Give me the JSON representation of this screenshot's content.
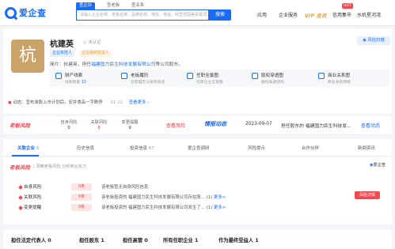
{
  "header": {
    "logo_text": "爱企查",
    "tabs": [
      "查企业",
      "查老板",
      "查关系"
    ],
    "search_placeholder": "请输入企业名称、老板名称、品牌名称、地址、电话、经营范围等关键词，如 \"阳光\"",
    "search_button": "搜索",
    "nav": [
      "应用",
      "企业服务"
    ],
    "vip": "VIP 会员",
    "hot_badge": "HOT",
    "nav2": [
      "信用集市",
      "水机星河湾"
    ]
  },
  "company": {
    "logo_char": "杭",
    "name": "杭建英",
    "cert": "未认证",
    "tags": [
      "企业实控人",
      "企业最终受益人"
    ],
    "intro_prefix": "简介：",
    "intro_person": "杭建英，",
    "intro_mid": "担任",
    "intro_company": "福建国力民生科技发展有限公司",
    "intro_suffix": "等公司股东。",
    "risk_scan_button": "风险扫描",
    "features": [
      {
        "title": "财产线索",
        "sub_prefix": "线索数量",
        "sub_value": "13"
      },
      {
        "title": "老板履历",
        "sub_prefix": "任职履历与投资情况",
        "sub_value": ""
      },
      {
        "title": "任职全景图",
        "sub_prefix": "任职企业全景图",
        "sub_value": ""
      },
      {
        "title": "股权穿透图",
        "sub_prefix": "股权穿透结构",
        "sub_value": ""
      },
      {
        "title": "商业关系图",
        "sub_prefix": "商业关系网络",
        "sub_value": ""
      }
    ],
    "dynamic_label": "动态：",
    "dynamic_text": "宜布准股上市计划后，安井食品一字跌停",
    "dynamic_time": "01-22",
    "dynamic_more": "查看更多"
  },
  "risk_strip": {
    "brand": "老板风险",
    "stats": [
      {
        "label": "自身风险",
        "value": "0",
        "red": false
      },
      {
        "label": "关联风险",
        "value": "8",
        "red": true
      },
      {
        "label": "变更提醒",
        "value": "9",
        "red": false
      }
    ],
    "view_risk": "查看风险",
    "brand2": "情报动态",
    "date": "2023-09-07",
    "news": "担任股东的 福建国力民生科技发...",
    "view_dynamic": "查看动态"
  },
  "tabs": [
    {
      "label": "关联企业",
      "count": "6"
    },
    {
      "label": "历史信息",
      "count": ""
    },
    {
      "label": "投资信息",
      "count": "67"
    },
    {
      "label": "爱企查调研",
      "count": ""
    },
    {
      "label": "风险提示",
      "count": ""
    },
    {
      "label": "合作伙伴",
      "count": ""
    },
    {
      "label": "新闻资讯",
      "count": ""
    }
  ],
  "boss_risk": {
    "brand": "老板风险",
    "sub": "| 洞察老板风险 分析商业实力",
    "logo": "爱企查",
    "rows": [
      {
        "label": "自身风险",
        "count": "0条",
        "text": "该老板暂无自身风险信息",
        "more": ""
      },
      {
        "label": "关联风险",
        "count": "8条",
        "text": "该老板投资的 福建国力民生科技发展有限公司存在股...  (1)",
        "more": "更多>"
      },
      {
        "label": "变更提醒",
        "count": "9条",
        "text": "该老板投资的 福建国力民生科技发展有限公司发生了...  (1)",
        "more": "更多>"
      }
    ],
    "detail_button": "风险详情"
  },
  "bottom_tabs": [
    {
      "label": "担任法定代表人",
      "count": "0"
    },
    {
      "label": "担任股东",
      "count": "1"
    },
    {
      "label": "担任高管",
      "count": "0"
    },
    {
      "label": "所有任职企业",
      "count": "1"
    },
    {
      "label": "作为最终受益人",
      "count": "1"
    }
  ],
  "colors": {
    "accent": "#1a6cf6",
    "danger": "#f2484f",
    "logo_bg": "#c9a36a"
  }
}
